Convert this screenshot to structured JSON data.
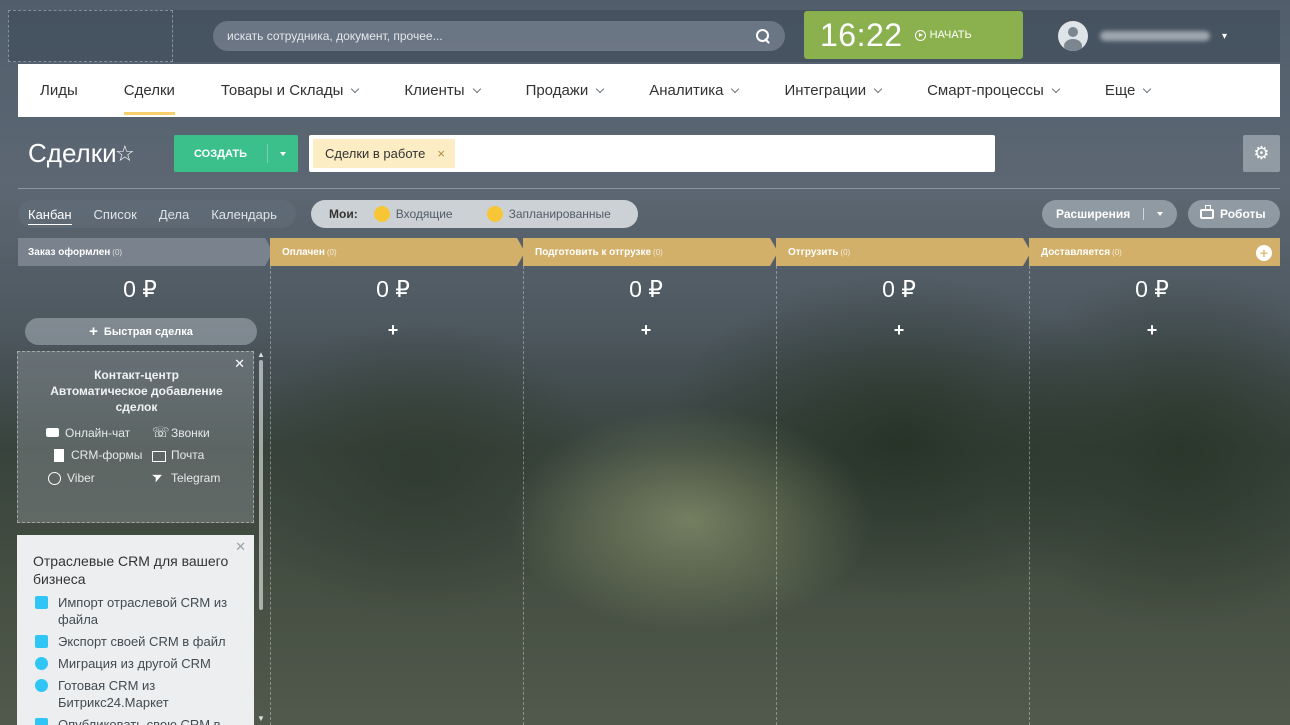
{
  "header": {
    "search_placeholder": "искать сотрудника, документ, прочее...",
    "clock_time": "16:22",
    "clock_start": "НАЧАТЬ"
  },
  "menu": [
    {
      "label": "Лиды",
      "dropdown": false
    },
    {
      "label": "Сделки",
      "dropdown": false,
      "active": true
    },
    {
      "label": "Товары и Склады",
      "dropdown": true
    },
    {
      "label": "Клиенты",
      "dropdown": true
    },
    {
      "label": "Продажи",
      "dropdown": true
    },
    {
      "label": "Аналитика",
      "dropdown": true
    },
    {
      "label": "Интеграции",
      "dropdown": true
    },
    {
      "label": "Смарт-процессы",
      "dropdown": true
    },
    {
      "label": "Еще",
      "dropdown": true
    }
  ],
  "page": {
    "title": "Сделки",
    "create_label": "СОЗДАТЬ",
    "filter_chip": "Сделки в работе",
    "chip_close": "×"
  },
  "views": {
    "items": [
      "Канбан",
      "Список",
      "Дела",
      "Календарь"
    ],
    "mine_label": "Мои:",
    "incoming": "Входящие",
    "planned": "Запланированные",
    "extensions": "Расширения",
    "robots": "Роботы"
  },
  "colors": {
    "stage1": "#7d8690",
    "stage": "#d2b06a",
    "create": "#3bc08c",
    "clock": "#8bb14f",
    "dot": "#f6c636"
  },
  "stages": [
    {
      "name": "Заказ оформлен",
      "count": "(0)",
      "sum": "0 ₽",
      "plus": "+"
    },
    {
      "name": "Оплачен",
      "count": "(0)",
      "sum": "0 ₽",
      "plus": "+"
    },
    {
      "name": "Подготовить к отгрузке",
      "count": "(0)",
      "sum": "0 ₽",
      "plus": "+"
    },
    {
      "name": "Отгрузить",
      "count": "(0)",
      "sum": "0 ₽",
      "plus": "+"
    },
    {
      "name": "Доставляется",
      "count": "(0)",
      "sum": "0 ₽",
      "plus": "+"
    }
  ],
  "quick_deal": "Быстрая сделка",
  "contact_center": {
    "title_line1": "Контакт-центр",
    "title_line2": "Автоматическое добавление",
    "title_line3": "сделок",
    "online_chat": "Онлайн-чат",
    "calls": "Звонки",
    "crm_forms": "CRM-формы",
    "mail": "Почта",
    "viber": "Viber",
    "telegram": "Telegram"
  },
  "industry_crm": {
    "title": "Отраслевые CRM для вашего бизнеса",
    "items": [
      "Импорт отраслевой CRM из файла",
      "Экспорт своей CRM в файл",
      "Миграция из другой CRM",
      "Готовая CRM из Битрикс24.Маркет",
      "Опубликовать свою CRM в"
    ]
  }
}
